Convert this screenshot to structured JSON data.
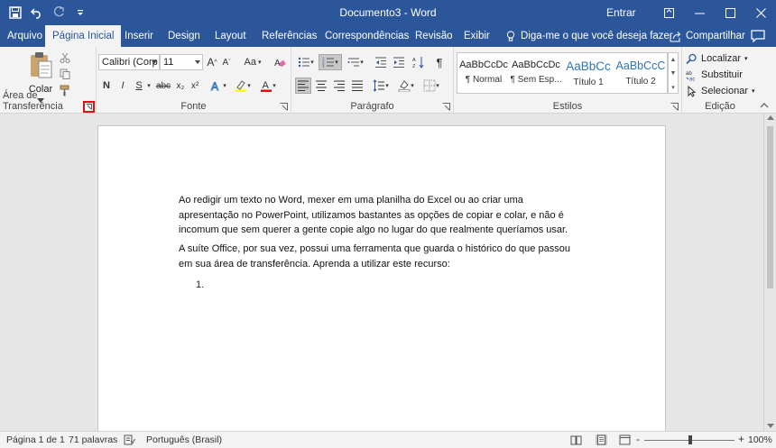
{
  "titlebar": {
    "title": "Documento3  -  Word",
    "signin": "Entrar",
    "qat": {
      "save_icon": "save-icon",
      "undo_icon": "undo-icon",
      "redo_icon": "redo-icon",
      "customize_icon": "customize-qat-icon"
    }
  },
  "tabs": {
    "items": [
      {
        "label": "Arquivo"
      },
      {
        "label": "Página Inicial"
      },
      {
        "label": "Inserir"
      },
      {
        "label": "Design"
      },
      {
        "label": "Layout"
      },
      {
        "label": "Referências"
      },
      {
        "label": "Correspondências"
      },
      {
        "label": "Revisão"
      },
      {
        "label": "Exibir"
      }
    ],
    "active_index": 1,
    "tellme": "Diga-me o que você deseja fazer",
    "share": "Compartilhar"
  },
  "ribbon": {
    "clipboard": {
      "label": "Área de Transferência",
      "paste": "Colar"
    },
    "font": {
      "label": "Fonte",
      "font_name": "Calibri (Corp",
      "font_size": "11",
      "bold": "N",
      "italic": "I",
      "underline": "S",
      "strike": "abc",
      "sub": "x₂",
      "sup": "x²",
      "grow": "A",
      "shrink": "A",
      "case": "Aa"
    },
    "paragraph": {
      "label": "Parágrafo"
    },
    "styles": {
      "label": "Estilos",
      "items": [
        {
          "sample": "AaBbCcDc",
          "name": "¶ Normal"
        },
        {
          "sample": "AaBbCcDc",
          "name": "¶ Sem Esp..."
        },
        {
          "sample": "AaBbCc",
          "name": "Título 1"
        },
        {
          "sample": "AaBbCcC",
          "name": "Título 2"
        }
      ]
    },
    "editing": {
      "label": "Edição",
      "find": "Localizar",
      "replace": "Substituir",
      "select": "Selecionar"
    }
  },
  "document": {
    "paragraphs": [
      "Ao redigir um texto no Word, mexer em uma planilha do Excel ou ao criar uma apresentação no PowerPoint, utilizamos bastantes as opções de copiar e colar, e não é incomum que sem querer a gente copie algo no lugar do que realmente queríamos usar.",
      "A suíte Office, por sua vez, possui uma ferramenta que guarda o histórico do que passou em sua área de transferência. Aprenda a utilizar este recurso:"
    ],
    "list_number": "1."
  },
  "status": {
    "page": "Página 1 de 1",
    "words": "71 palavras",
    "language": "Português (Brasil)",
    "zoom_minus": "-",
    "zoom_plus": "+",
    "zoom": "100%"
  },
  "colors": {
    "accent": "#2b579a",
    "highlight_marker": "#e01010",
    "heading_blue": "#2e74b5"
  }
}
